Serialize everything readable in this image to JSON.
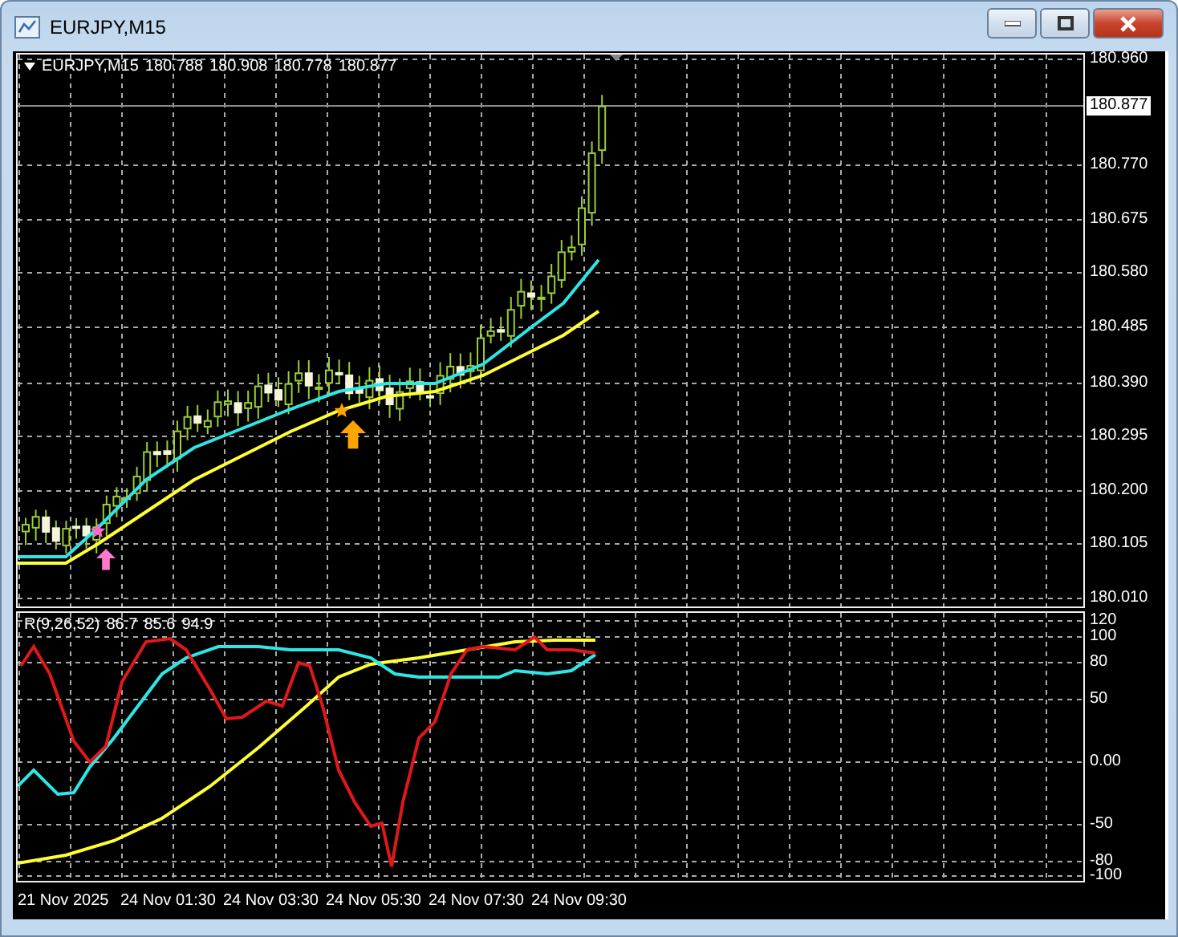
{
  "window": {
    "title": "EURJPY,M15",
    "buttons": [
      {
        "kind": "minimize"
      },
      {
        "kind": "maximize"
      },
      {
        "kind": "close"
      }
    ]
  },
  "main_pane": {
    "symbol": "EURJPY,M15",
    "ohlc": [
      "180.788",
      "180.908",
      "180.778",
      "180.877"
    ],
    "current_price": "180.877",
    "price_axis": [
      "180.960",
      "180.770",
      "180.675",
      "180.580",
      "180.485",
      "180.390",
      "180.295",
      "180.200",
      "180.105",
      "180.010"
    ]
  },
  "indicator_pane": {
    "name": "R(9,26,52)",
    "values": [
      "86.7",
      "85.6",
      "94.9"
    ],
    "axis": [
      "120",
      "100",
      "80",
      "50",
      "0.00",
      "-50",
      "-80",
      "-100"
    ]
  },
  "time_axis": [
    "21 Nov 2025",
    "24 Nov 01:30",
    "24 Nov 03:30",
    "24 Nov 05:30",
    "24 Nov 07:30",
    "24 Nov 09:30"
  ]
}
